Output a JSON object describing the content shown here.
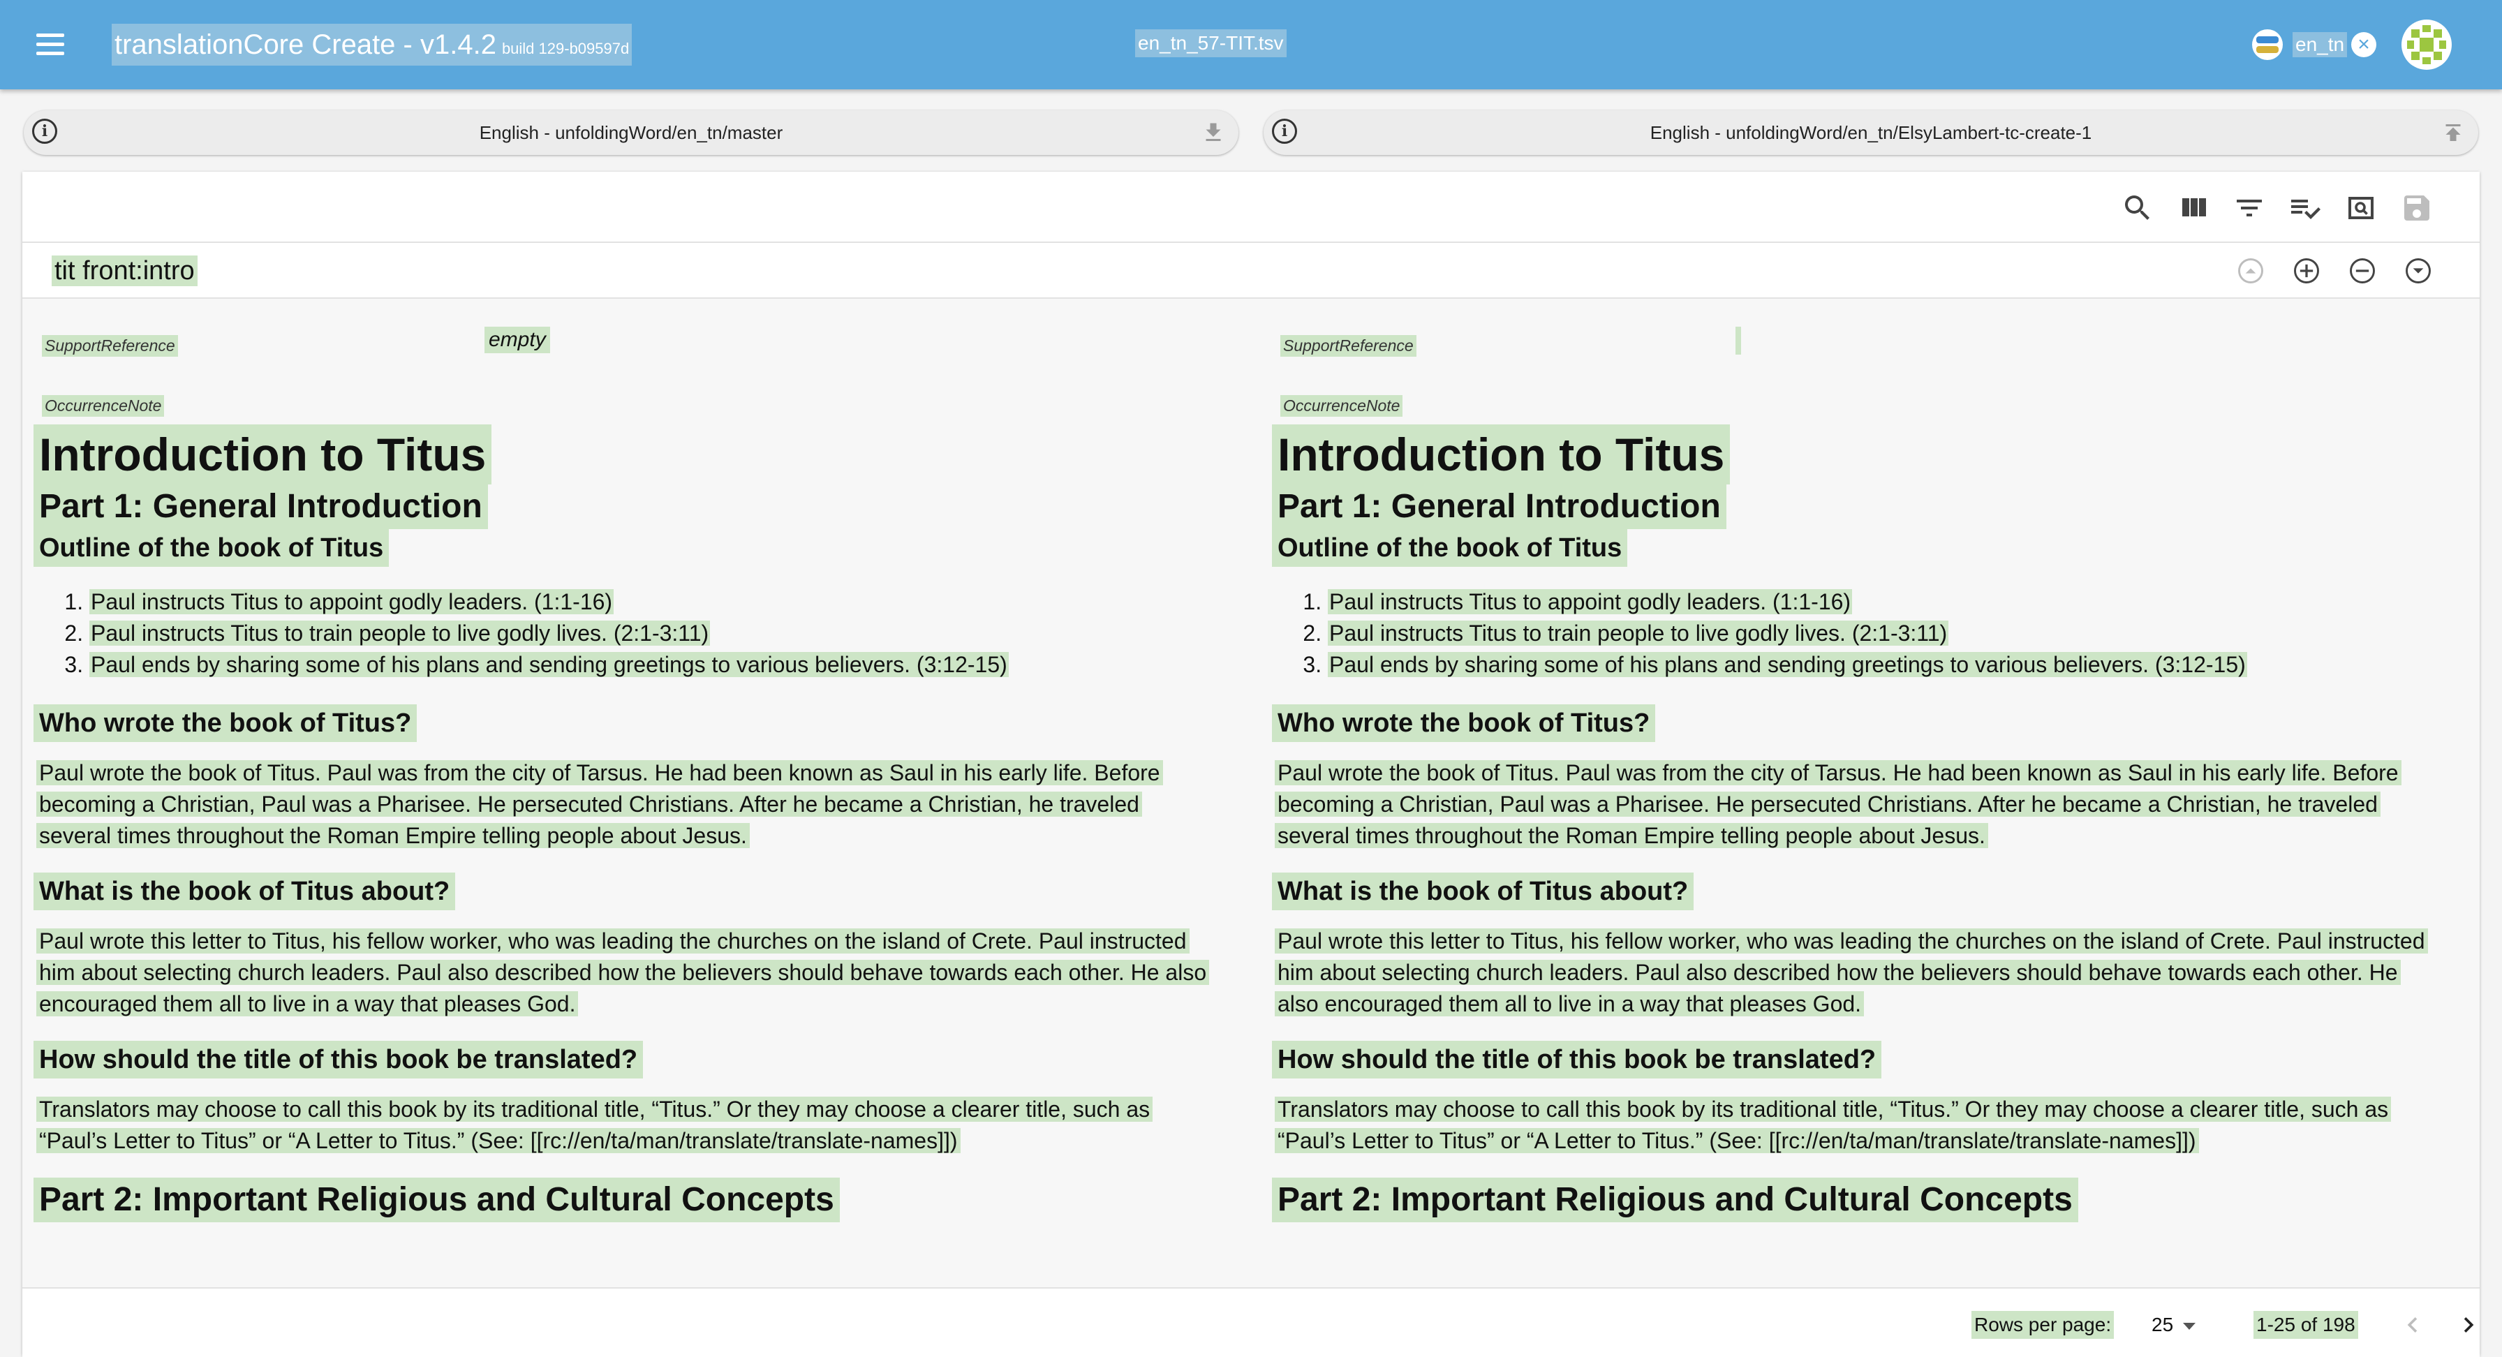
{
  "app": {
    "title": "translationCore Create - v1.4.2",
    "build": "build 129-b09597d",
    "file_name": "en_tn_57-TIT.tsv",
    "language": "en_tn"
  },
  "resources": {
    "left_label": "English - unfoldingWord/en_tn/master",
    "right_label": "English - unfoldingWord/en_tn/ElsyLambert-tc-create-1"
  },
  "row": {
    "id": "tit front:intro"
  },
  "fields": {
    "support_reference": "SupportReference",
    "occurrence_note": "OccurrenceNote",
    "left_support_value": "empty"
  },
  "note": {
    "h1": "Introduction to Titus",
    "part1": "Part 1: General Introduction",
    "outline_heading": "Outline of the book of Titus",
    "outline": [
      "Paul instructs Titus to appoint godly leaders. (1:1-16)",
      "Paul instructs Titus to train people to live godly lives. (2:1-3:11)",
      "Paul ends by sharing some of his plans and sending greetings to various believers. (3:12-15)"
    ],
    "q1": "Who wrote the book of Titus?",
    "a1_left": [
      "Paul wrote the book of Titus. Paul was from the city of Tarsus. He had been known as Saul in his early life. Before",
      "becoming a Christian, Paul was a Pharisee. He persecuted Christians. After he became a Christian, he traveled",
      "several times throughout the Roman Empire telling people about Jesus."
    ],
    "a1_right": [
      "Paul wrote the book of Titus. Paul was from the city of Tarsus. He had been known as Saul in his early life. Before",
      "becoming a Christian, Paul was a Pharisee. He persecuted Christians. After he became a Christian, he traveled",
      "several times throughout the Roman Empire telling people about Jesus."
    ],
    "q2": "What is the book of Titus about?",
    "a2_left": [
      "Paul wrote this letter to Titus, his fellow worker, who was leading the churches on the island of Crete. Paul instructed",
      "him about selecting church leaders. Paul also described how the believers should behave towards each other. He also",
      "encouraged them all to live in a way that pleases God."
    ],
    "a2_right": [
      "Paul wrote this letter to Titus, his fellow worker, who was leading the churches on the island of Crete. Paul instructed",
      "him about selecting church leaders. Paul also described how the believers should behave towards each other. He",
      "also encouraged them all to live in a way that pleases God."
    ],
    "q3": "How should the title of this book be translated?",
    "a3": [
      "Translators may choose to call this book by its traditional title, “Titus.” Or they may choose a clearer title, such as",
      "“Paul’s Letter to Titus” or “A Letter to Titus.” (See: [[rc://en/ta/man/translate/translate-names]])"
    ],
    "part2": "Part 2: Important Religious and Cultural Concepts"
  },
  "footer": {
    "rows_per_page_label": "Rows per page:",
    "rows_per_page_value": "25",
    "range": "1-25 of 198"
  },
  "colors": {
    "app_bar": "#5aa7dc",
    "highlight": "#cde5c6"
  },
  "icons": [
    "menu-icon",
    "info-icon",
    "download-icon",
    "upload-icon",
    "search-icon",
    "view-column-icon",
    "filter-icon",
    "playlist-check-icon",
    "preview-icon",
    "save-icon",
    "expand-less-icon",
    "add-circle-icon",
    "remove-circle-icon",
    "expand-more-icon",
    "chevron-left-icon",
    "chevron-right-icon"
  ]
}
